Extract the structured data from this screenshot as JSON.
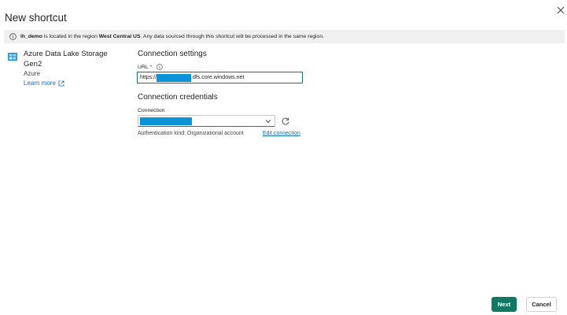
{
  "dialog": {
    "title": "New shortcut"
  },
  "info": {
    "lakehouse": "lh_demo",
    "text_1": " is located in the region ",
    "region": "West Central US",
    "text_2": ". Any data sourced through this shortcut will be processed in the same region."
  },
  "source": {
    "name": "Azure Data Lake Storage Gen2",
    "provider": "Azure",
    "learn_more": "Learn more",
    "icon": "azure-storage-icon"
  },
  "connection_settings": {
    "title": "Connection settings",
    "url_label": "URL",
    "required_mark": "*",
    "url_prefix": "https://",
    "url_suffix": ".dfs.core.windows.net"
  },
  "connection_credentials": {
    "title": "Connection credentials",
    "connection_label": "Connection",
    "auth_kind": "Authentication kind: Organizational account",
    "edit_link": "Edit connection"
  },
  "footer": {
    "next_label": "Next",
    "cancel_label": "Cancel"
  },
  "colors": {
    "accent": "#117865",
    "link": "#0f6cbd",
    "redaction": "#0a93d8",
    "info_bar_bg": "#f0f0f0"
  }
}
